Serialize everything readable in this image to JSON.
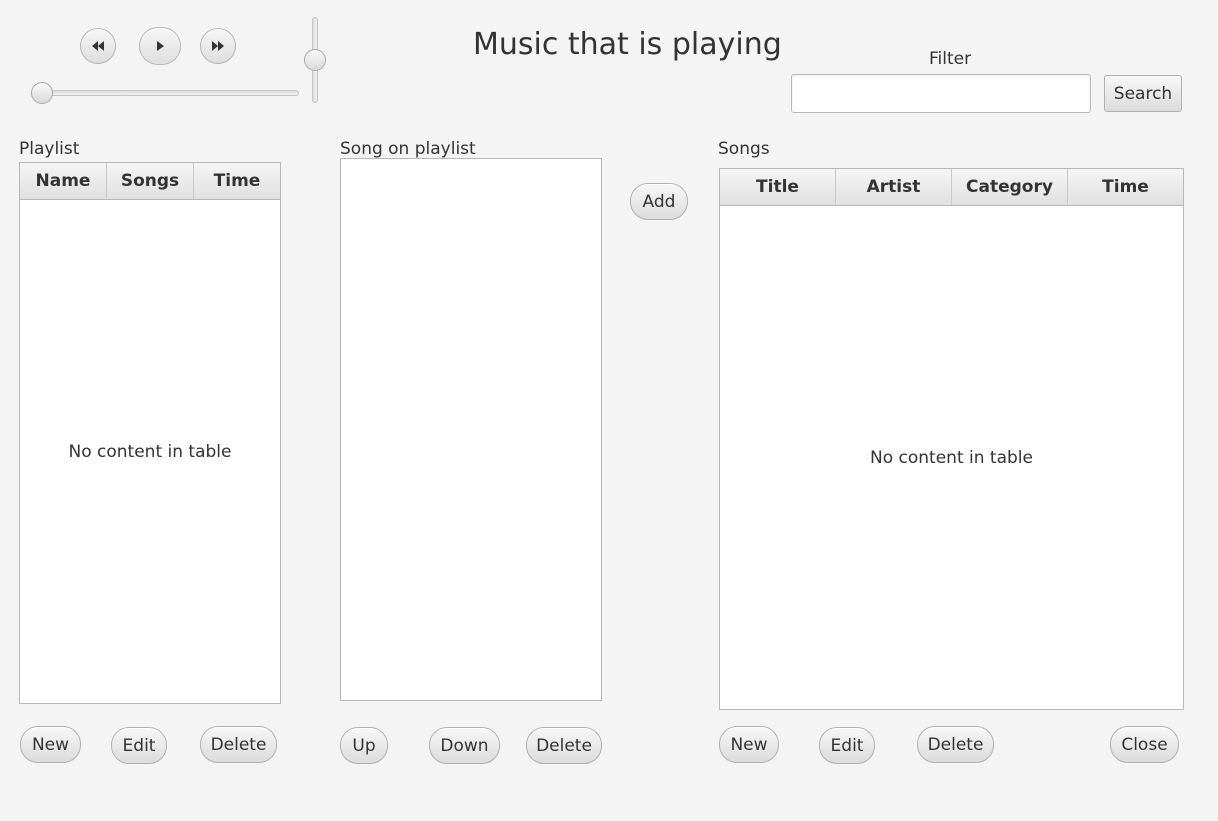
{
  "app": {
    "title": "Music that is playing"
  },
  "player": {
    "controls": [
      {
        "name": "rewind-button",
        "icon": "rewind-icon"
      },
      {
        "name": "play-button",
        "icon": "play-icon"
      },
      {
        "name": "fast-forward-button",
        "icon": "fast-forward-icon"
      }
    ],
    "progress_fraction": 0,
    "volume_fraction": 0.5
  },
  "filter": {
    "label": "Filter",
    "value": "",
    "placeholder": "",
    "search_label": "Search"
  },
  "playlists": {
    "label": "Playlist",
    "columns": [
      "Name",
      "Songs",
      "Time"
    ],
    "rows": [],
    "empty_text": "No content in table",
    "buttons": {
      "new": "New",
      "edit": "Edit",
      "delete": "Delete"
    }
  },
  "playlist_songs": {
    "label": "Song on playlist",
    "items": [],
    "add_label": "Add",
    "buttons": {
      "up": "Up",
      "down": "Down",
      "delete": "Delete"
    }
  },
  "songs": {
    "label": "Songs",
    "columns": [
      "Title",
      "Artist",
      "Category",
      "Time"
    ],
    "rows": [],
    "empty_text": "No content in table",
    "buttons": {
      "new": "New",
      "edit": "Edit",
      "delete": "Delete",
      "close": "Close"
    }
  }
}
